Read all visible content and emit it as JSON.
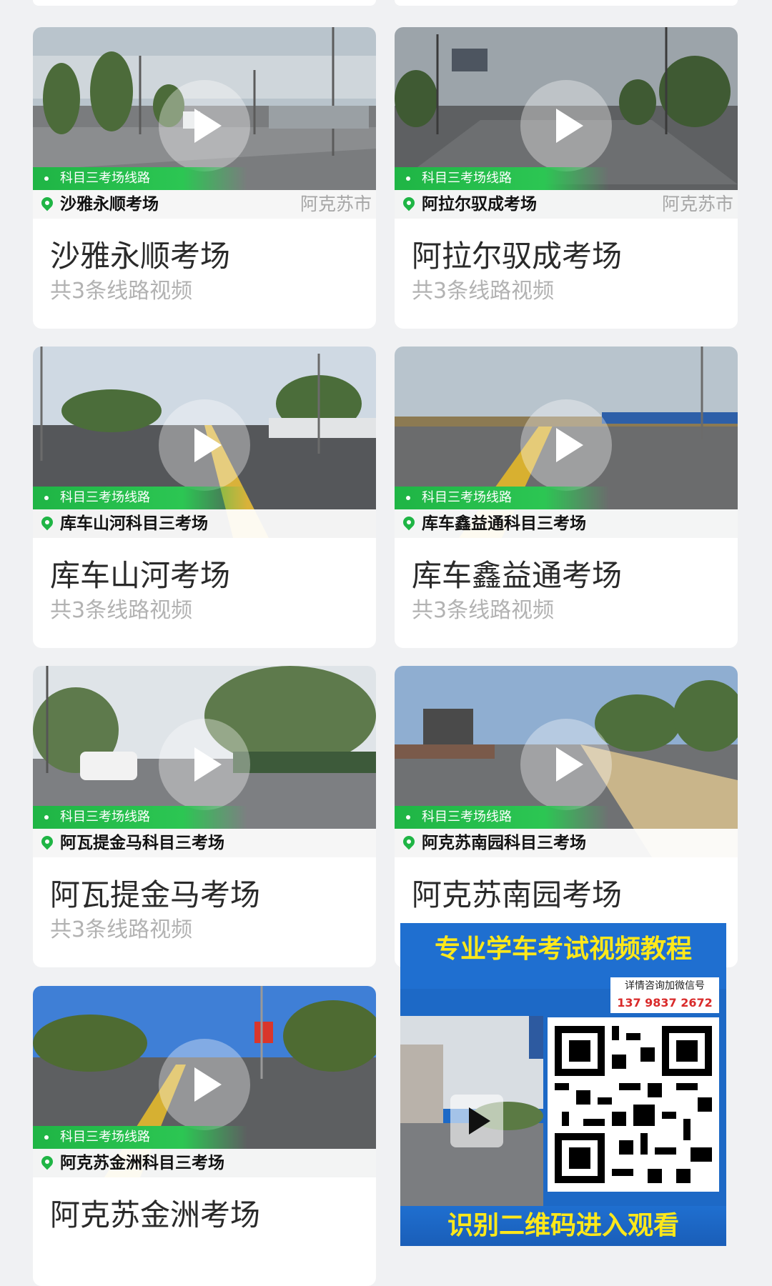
{
  "cards": [
    {
      "tag": "科目三考场线路",
      "location": "沙雅永顺考场",
      "city": "阿克苏市",
      "title": "沙雅永顺考场",
      "subtitle": "共3条线路视频"
    },
    {
      "tag": "科目三考场线路",
      "location": "阿拉尔驭成考场",
      "city": "阿克苏市",
      "title": "阿拉尔驭成考场",
      "subtitle": "共3条线路视频"
    },
    {
      "tag": "科目三考场线路",
      "location": "库车山河科目三考场",
      "city": "",
      "title": "库车山河考场",
      "subtitle": "共3条线路视频"
    },
    {
      "tag": "科目三考场线路",
      "location": "库车鑫益通科目三考场",
      "city": "",
      "title": "库车鑫益通考场",
      "subtitle": "共3条线路视频"
    },
    {
      "tag": "科目三考场线路",
      "location": "阿瓦提金马科目三考场",
      "city": "",
      "title": "阿瓦提金马考场",
      "subtitle": "共3条线路视频"
    },
    {
      "tag": "科目三考场线路",
      "location": "阿克苏南园科目三考场",
      "city": "",
      "title": "阿克苏南园考场",
      "subtitle": ""
    },
    {
      "tag": "科目三考场线路",
      "location": "阿克苏金洲科目三考场",
      "city": "",
      "title": "阿克苏金洲考场",
      "subtitle": ""
    }
  ],
  "ad": {
    "headline": "专业学车考试视频教程",
    "contact_label": "详情咨询加微信号",
    "phone": "137 9837 2672",
    "footer": "识别二维码进入观看"
  },
  "colors": {
    "accent_green": "#1fb545",
    "ad_blue": "#1d69c6",
    "ad_yellow": "#ffe81a"
  }
}
